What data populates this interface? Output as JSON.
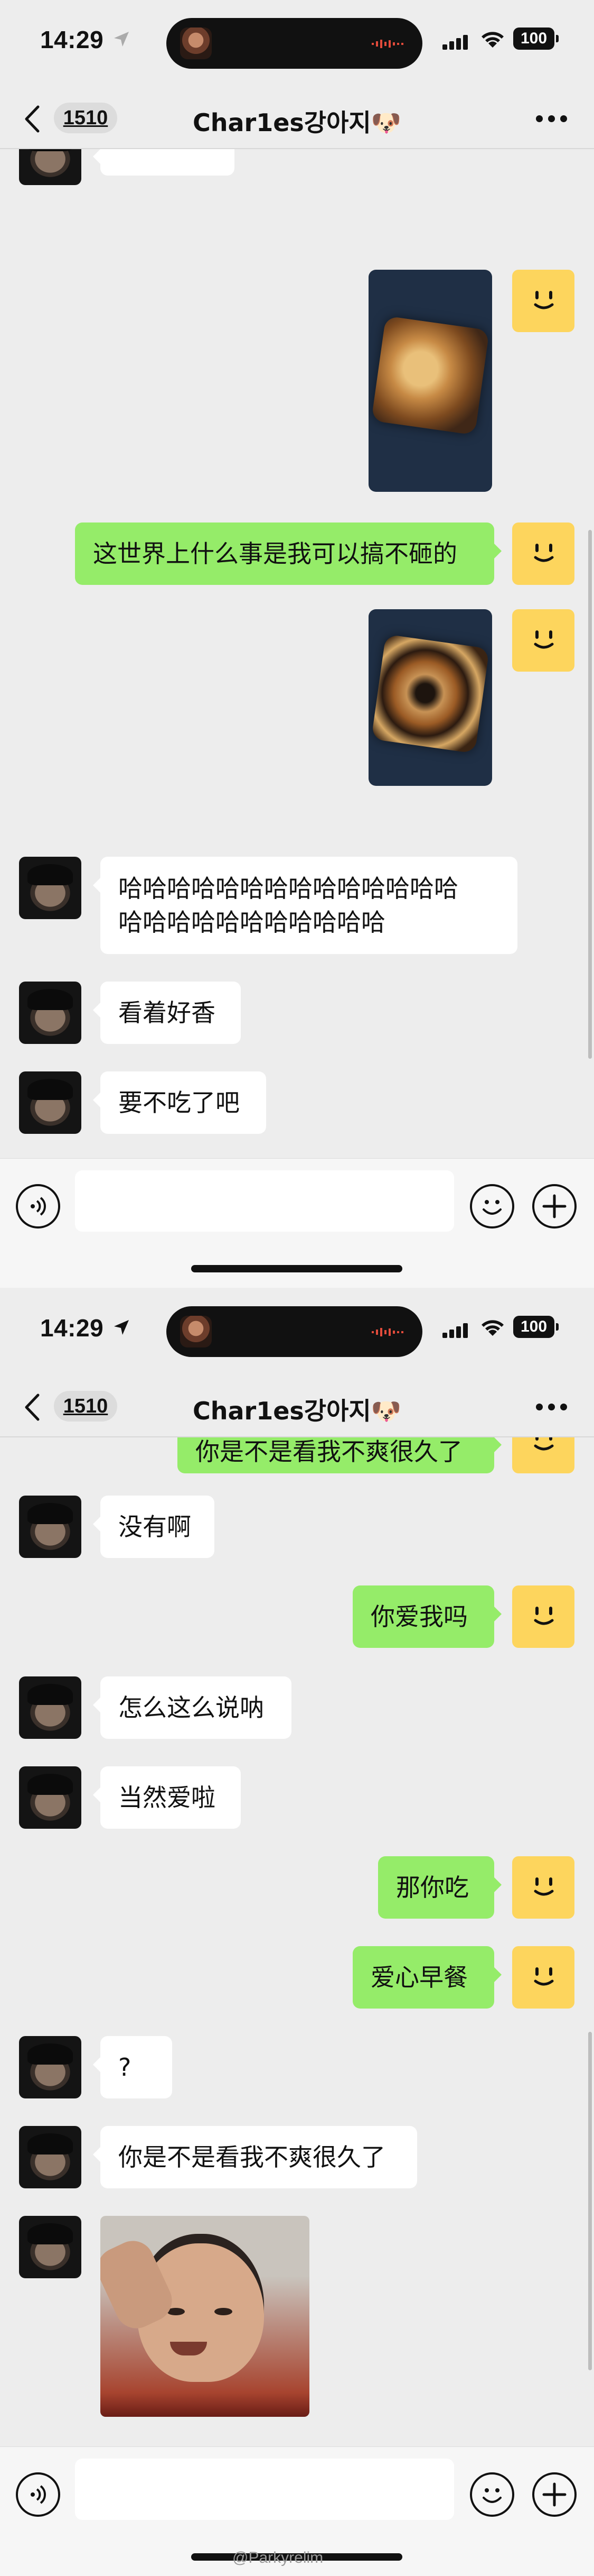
{
  "screen1": {
    "status": {
      "time": "14:29",
      "battery": "100"
    },
    "nav": {
      "unread_badge": "1510",
      "chat_title": "Char1es강아지🐶"
    },
    "messages": {
      "m1_text": "这世界上什么事是我可以搞不砸的",
      "m2_text": "哈哈哈哈哈哈哈哈哈哈哈哈哈哈\n哈哈哈哈哈哈哈哈哈哈哈",
      "m3_text": "看着好香",
      "m4_text": "要不吃了吧"
    }
  },
  "screen2": {
    "status": {
      "time": "14:29",
      "battery": "100"
    },
    "nav": {
      "unread_badge": "1510",
      "chat_title": "Char1es강아지🐶"
    },
    "messages": {
      "m0_text": "你是不是看我不爽很久了",
      "m1_text": "没有啊",
      "m2_text": "你爱我吗",
      "m3_text": "怎么这么说呐",
      "m4_text": "当然爱啦",
      "m5_text": "那你吃",
      "m6_text": "爱心早餐",
      "m7_text": "?",
      "m8_text": "你是不是看我不爽很久了"
    }
  },
  "icons": [
    "back-chevron-icon",
    "more-dots-icon",
    "voice-icon",
    "emoji-icon",
    "plus-icon",
    "signal-icon",
    "wifi-icon",
    "battery-icon",
    "location-arrow-icon"
  ],
  "colors": {
    "my_bubble": "#95ec69",
    "their_bubble": "#ffffff",
    "background": "#ededed",
    "my_avatar": "#fdd55d"
  },
  "watermark": "@Parkyrelim"
}
